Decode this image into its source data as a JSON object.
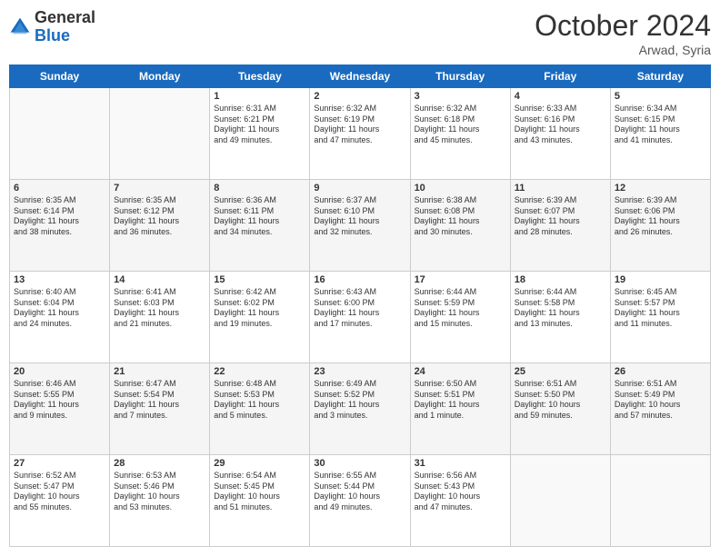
{
  "logo": {
    "general": "General",
    "blue": "Blue"
  },
  "header": {
    "month": "October 2024",
    "location": "Arwad, Syria"
  },
  "days_of_week": [
    "Sunday",
    "Monday",
    "Tuesday",
    "Wednesday",
    "Thursday",
    "Friday",
    "Saturday"
  ],
  "weeks": [
    [
      {
        "day": "",
        "lines": []
      },
      {
        "day": "",
        "lines": []
      },
      {
        "day": "1",
        "lines": [
          "Sunrise: 6:31 AM",
          "Sunset: 6:21 PM",
          "Daylight: 11 hours",
          "and 49 minutes."
        ]
      },
      {
        "day": "2",
        "lines": [
          "Sunrise: 6:32 AM",
          "Sunset: 6:19 PM",
          "Daylight: 11 hours",
          "and 47 minutes."
        ]
      },
      {
        "day": "3",
        "lines": [
          "Sunrise: 6:32 AM",
          "Sunset: 6:18 PM",
          "Daylight: 11 hours",
          "and 45 minutes."
        ]
      },
      {
        "day": "4",
        "lines": [
          "Sunrise: 6:33 AM",
          "Sunset: 6:16 PM",
          "Daylight: 11 hours",
          "and 43 minutes."
        ]
      },
      {
        "day": "5",
        "lines": [
          "Sunrise: 6:34 AM",
          "Sunset: 6:15 PM",
          "Daylight: 11 hours",
          "and 41 minutes."
        ]
      }
    ],
    [
      {
        "day": "6",
        "lines": [
          "Sunrise: 6:35 AM",
          "Sunset: 6:14 PM",
          "Daylight: 11 hours",
          "and 38 minutes."
        ]
      },
      {
        "day": "7",
        "lines": [
          "Sunrise: 6:35 AM",
          "Sunset: 6:12 PM",
          "Daylight: 11 hours",
          "and 36 minutes."
        ]
      },
      {
        "day": "8",
        "lines": [
          "Sunrise: 6:36 AM",
          "Sunset: 6:11 PM",
          "Daylight: 11 hours",
          "and 34 minutes."
        ]
      },
      {
        "day": "9",
        "lines": [
          "Sunrise: 6:37 AM",
          "Sunset: 6:10 PM",
          "Daylight: 11 hours",
          "and 32 minutes."
        ]
      },
      {
        "day": "10",
        "lines": [
          "Sunrise: 6:38 AM",
          "Sunset: 6:08 PM",
          "Daylight: 11 hours",
          "and 30 minutes."
        ]
      },
      {
        "day": "11",
        "lines": [
          "Sunrise: 6:39 AM",
          "Sunset: 6:07 PM",
          "Daylight: 11 hours",
          "and 28 minutes."
        ]
      },
      {
        "day": "12",
        "lines": [
          "Sunrise: 6:39 AM",
          "Sunset: 6:06 PM",
          "Daylight: 11 hours",
          "and 26 minutes."
        ]
      }
    ],
    [
      {
        "day": "13",
        "lines": [
          "Sunrise: 6:40 AM",
          "Sunset: 6:04 PM",
          "Daylight: 11 hours",
          "and 24 minutes."
        ]
      },
      {
        "day": "14",
        "lines": [
          "Sunrise: 6:41 AM",
          "Sunset: 6:03 PM",
          "Daylight: 11 hours",
          "and 21 minutes."
        ]
      },
      {
        "day": "15",
        "lines": [
          "Sunrise: 6:42 AM",
          "Sunset: 6:02 PM",
          "Daylight: 11 hours",
          "and 19 minutes."
        ]
      },
      {
        "day": "16",
        "lines": [
          "Sunrise: 6:43 AM",
          "Sunset: 6:00 PM",
          "Daylight: 11 hours",
          "and 17 minutes."
        ]
      },
      {
        "day": "17",
        "lines": [
          "Sunrise: 6:44 AM",
          "Sunset: 5:59 PM",
          "Daylight: 11 hours",
          "and 15 minutes."
        ]
      },
      {
        "day": "18",
        "lines": [
          "Sunrise: 6:44 AM",
          "Sunset: 5:58 PM",
          "Daylight: 11 hours",
          "and 13 minutes."
        ]
      },
      {
        "day": "19",
        "lines": [
          "Sunrise: 6:45 AM",
          "Sunset: 5:57 PM",
          "Daylight: 11 hours",
          "and 11 minutes."
        ]
      }
    ],
    [
      {
        "day": "20",
        "lines": [
          "Sunrise: 6:46 AM",
          "Sunset: 5:55 PM",
          "Daylight: 11 hours",
          "and 9 minutes."
        ]
      },
      {
        "day": "21",
        "lines": [
          "Sunrise: 6:47 AM",
          "Sunset: 5:54 PM",
          "Daylight: 11 hours",
          "and 7 minutes."
        ]
      },
      {
        "day": "22",
        "lines": [
          "Sunrise: 6:48 AM",
          "Sunset: 5:53 PM",
          "Daylight: 11 hours",
          "and 5 minutes."
        ]
      },
      {
        "day": "23",
        "lines": [
          "Sunrise: 6:49 AM",
          "Sunset: 5:52 PM",
          "Daylight: 11 hours",
          "and 3 minutes."
        ]
      },
      {
        "day": "24",
        "lines": [
          "Sunrise: 6:50 AM",
          "Sunset: 5:51 PM",
          "Daylight: 11 hours",
          "and 1 minute."
        ]
      },
      {
        "day": "25",
        "lines": [
          "Sunrise: 6:51 AM",
          "Sunset: 5:50 PM",
          "Daylight: 10 hours",
          "and 59 minutes."
        ]
      },
      {
        "day": "26",
        "lines": [
          "Sunrise: 6:51 AM",
          "Sunset: 5:49 PM",
          "Daylight: 10 hours",
          "and 57 minutes."
        ]
      }
    ],
    [
      {
        "day": "27",
        "lines": [
          "Sunrise: 6:52 AM",
          "Sunset: 5:47 PM",
          "Daylight: 10 hours",
          "and 55 minutes."
        ]
      },
      {
        "day": "28",
        "lines": [
          "Sunrise: 6:53 AM",
          "Sunset: 5:46 PM",
          "Daylight: 10 hours",
          "and 53 minutes."
        ]
      },
      {
        "day": "29",
        "lines": [
          "Sunrise: 6:54 AM",
          "Sunset: 5:45 PM",
          "Daylight: 10 hours",
          "and 51 minutes."
        ]
      },
      {
        "day": "30",
        "lines": [
          "Sunrise: 6:55 AM",
          "Sunset: 5:44 PM",
          "Daylight: 10 hours",
          "and 49 minutes."
        ]
      },
      {
        "day": "31",
        "lines": [
          "Sunrise: 6:56 AM",
          "Sunset: 5:43 PM",
          "Daylight: 10 hours",
          "and 47 minutes."
        ]
      },
      {
        "day": "",
        "lines": []
      },
      {
        "day": "",
        "lines": []
      }
    ]
  ]
}
